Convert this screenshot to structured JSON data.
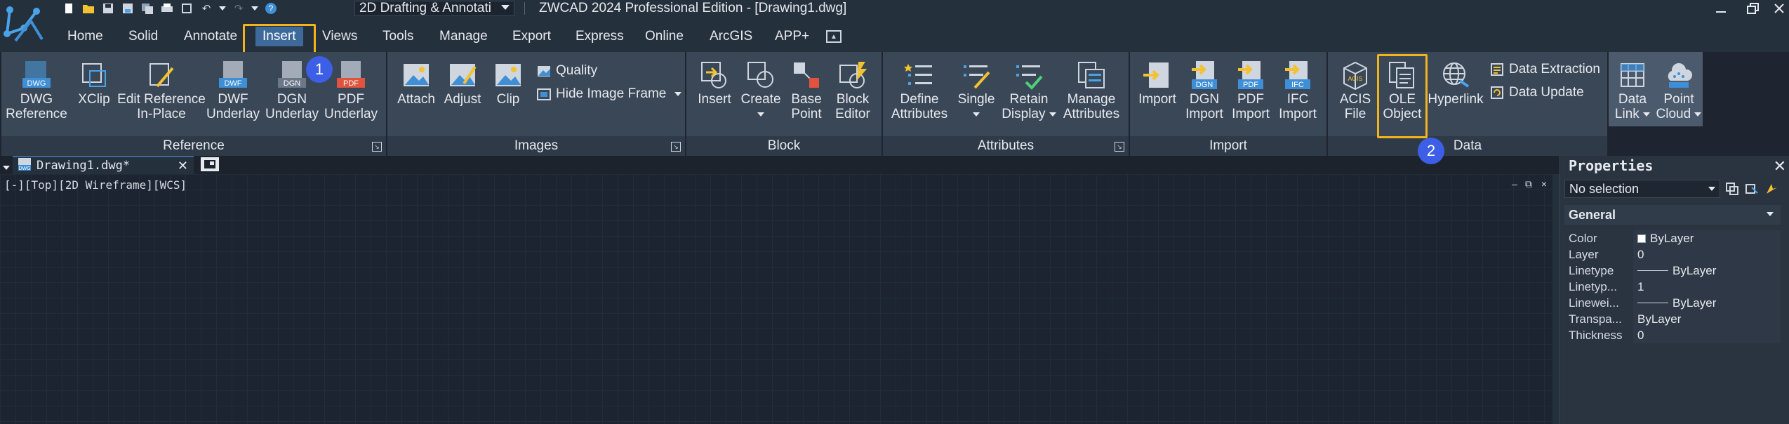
{
  "titlebar": {
    "workspace": "2D Drafting & Annotati",
    "app_title": "ZWCAD 2024 Professional Edition - [Drawing1.dwg]",
    "qat_icons": [
      "new-file-icon",
      "open-folder-icon",
      "save-icon",
      "save-as-icon",
      "multi-save-icon",
      "print-icon",
      "publish-icon",
      "undo-icon",
      "redo-icon",
      "help-icon"
    ]
  },
  "menu": {
    "tabs": [
      "Home",
      "Solid",
      "Annotate",
      "Insert",
      "Views",
      "Tools",
      "Manage",
      "Export",
      "Express",
      "Online",
      "ArcGIS",
      "APP+"
    ],
    "active_tab": "Insert"
  },
  "badges": {
    "one": "1",
    "two": "2"
  },
  "ribbon": {
    "reference": {
      "title": "Reference",
      "buttons": [
        {
          "line1": "DWG",
          "line2": "Reference",
          "icon": "dwg-reference-icon",
          "icon_text": "DWG"
        },
        {
          "line1": "XClip",
          "line2": "",
          "icon": "xclip-icon"
        },
        {
          "line1": "Edit Reference",
          "line2": "In-Place",
          "icon": "edit-reference-icon"
        },
        {
          "line1": "DWF",
          "line2": "Underlay",
          "icon": "dwf-underlay-icon",
          "icon_text": "DWF"
        },
        {
          "line1": "DGN",
          "line2": "Underlay",
          "icon": "dgn-underlay-icon",
          "icon_text": "DGN"
        },
        {
          "line1": "PDF",
          "line2": "Underlay",
          "icon": "pdf-underlay-icon",
          "icon_text": "PDF"
        }
      ]
    },
    "images": {
      "title": "Images",
      "buttons": [
        {
          "line1": "Attach",
          "icon": "attach-image-icon"
        },
        {
          "line1": "Adjust",
          "icon": "adjust-image-icon"
        },
        {
          "line1": "Clip",
          "icon": "clip-image-icon"
        }
      ],
      "quality": "Quality",
      "hide_frame": "Hide Image Frame"
    },
    "block": {
      "title": "Block",
      "buttons": [
        {
          "line1": "Insert",
          "line2": "",
          "icon": "insert-block-icon"
        },
        {
          "line1": "Create",
          "line2": "",
          "icon": "create-block-icon"
        },
        {
          "line1": "Base",
          "line2": "Point",
          "icon": "base-point-icon"
        },
        {
          "line1": "Block",
          "line2": "Editor",
          "icon": "block-editor-icon"
        }
      ]
    },
    "attributes": {
      "title": "Attributes",
      "buttons": [
        {
          "line1": "Define",
          "line2": "Attributes",
          "icon": "define-attributes-icon"
        },
        {
          "line1": "Single",
          "line2": "",
          "icon": "single-attribute-icon"
        },
        {
          "line1": "Retain",
          "line2": "Display",
          "icon": "retain-display-icon"
        },
        {
          "line1": "Manage",
          "line2": "Attributes",
          "icon": "manage-attributes-icon"
        }
      ]
    },
    "import": {
      "title": "Import",
      "buttons": [
        {
          "line1": "Import",
          "line2": "",
          "icon": "import-icon"
        },
        {
          "line1": "DGN",
          "line2": "Import",
          "icon": "dgn-import-icon",
          "icon_text": "DGN"
        },
        {
          "line1": "PDF",
          "line2": "Import",
          "icon": "pdf-import-icon",
          "icon_text": "PDF"
        },
        {
          "line1": "IFC",
          "line2": "Import",
          "icon": "ifc-import-icon",
          "icon_text": "IFC"
        }
      ]
    },
    "data": {
      "title": "Data",
      "buttons": [
        {
          "line1": "ACIS",
          "line2": "File",
          "icon": "acis-file-icon",
          "icon_text": "ACIS"
        },
        {
          "line1": "OLE",
          "line2": "Object",
          "icon": "ole-object-icon"
        },
        {
          "line1": "Hyperlink",
          "line2": "",
          "icon": "hyperlink-globe-icon"
        }
      ],
      "data_extraction": "Data Extraction",
      "data_update": "Data Update"
    },
    "data_link": {
      "line1": "Data",
      "line2": "Link"
    },
    "point_cloud": {
      "line1": "Point",
      "line2": "Cloud"
    }
  },
  "file_tab": {
    "name": "Drawing1.dwg*",
    "icon_text": "DWG"
  },
  "viewport": {
    "label": "[-][Top][2D Wireframe][WCS]"
  },
  "properties": {
    "title": "Properties",
    "selection": "No selection",
    "category": "General",
    "rows": [
      {
        "key": "Color",
        "value": "ByLayer",
        "kind": "swatch"
      },
      {
        "key": "Layer",
        "value": "0",
        "kind": "text"
      },
      {
        "key": "Linetype",
        "value": "ByLayer",
        "kind": "line"
      },
      {
        "key": "Linetyp...",
        "value": "1",
        "kind": "text"
      },
      {
        "key": "Linewei...",
        "value": "ByLayer",
        "kind": "line"
      },
      {
        "key": "Transpa...",
        "value": "ByLayer",
        "kind": "text"
      },
      {
        "key": "Thickness",
        "value": "0",
        "kind": "text"
      }
    ]
  },
  "colors": {
    "accent_highlight": "#f3b41b",
    "badge_blue": "#3d5ee6",
    "active_tab": "#3d6a9b",
    "icon_blue": "#4aa3e8",
    "icon_yellow": "#f2c230",
    "icon_red": "#e0533e"
  }
}
